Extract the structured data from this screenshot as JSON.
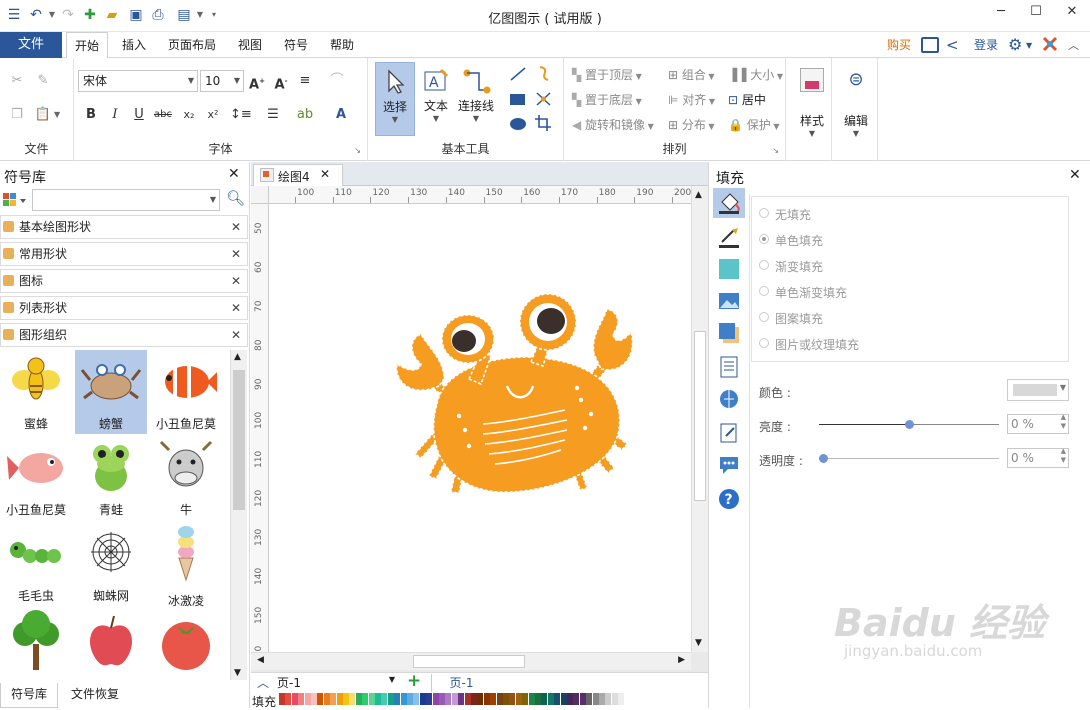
{
  "window": {
    "title": "亿图图示 ( 试用版 )"
  },
  "titlebar_right": {
    "buy": "购买",
    "login": "登录"
  },
  "tabs": {
    "file": "文件",
    "home": "开始",
    "insert": "插入",
    "page_layout": "页面布局",
    "view": "视图",
    "symbol": "符号",
    "help": "帮助"
  },
  "ribbon": {
    "groups": {
      "file": "文件",
      "font": "字体",
      "basic_tools": "基本工具",
      "arrange": "排列"
    },
    "font_name": "宋体",
    "font_size": "10",
    "tools": {
      "select": "选择",
      "text": "文本",
      "connector": "连接线"
    },
    "arrange": {
      "bring_front": "置于顶层",
      "send_back": "置于底层",
      "rotate": "旋转和镜像",
      "group": "组合",
      "align": "对齐",
      "distribute": "分布",
      "size": "大小",
      "center": "居中",
      "protect": "保护"
    },
    "style": "样式",
    "edit": "编辑"
  },
  "library": {
    "title": "符号库",
    "search_placeholder": "",
    "categories": [
      "基本绘图形状",
      "常用形状",
      "图标",
      "列表形状",
      "图形组织"
    ],
    "symbols": [
      "蜜蜂",
      "螃蟹",
      "小丑鱼尼莫",
      "小丑鱼尼莫",
      "青蛙",
      "牛",
      "毛毛虫",
      "蜘蛛网",
      "冰激凌"
    ],
    "bottom_tabs": {
      "library": "符号库",
      "recovery": "文件恢复"
    }
  },
  "document": {
    "tab": "绘图4",
    "ruler_h": [
      "100",
      "110",
      "120",
      "130",
      "140",
      "150",
      "160",
      "170",
      "180",
      "190",
      "200"
    ],
    "ruler_v": [
      "50",
      "60",
      "70",
      "80",
      "90",
      "100",
      "110",
      "120",
      "130",
      "140",
      "150",
      "160"
    ],
    "page_combo": "页-1",
    "page_tab": "页-1"
  },
  "fill_panel": {
    "title": "填充",
    "options": [
      "无填充",
      "单色填充",
      "渐变填充",
      "单色渐变填充",
      "图案填充",
      "图片或纹理填充"
    ],
    "color_label": "颜色 :",
    "brightness_label": "亮度 :",
    "brightness_value": "0 %",
    "brightness_level": 0.5,
    "transparency_label": "透明度 :",
    "transparency_value": "0 %",
    "transparency_level": 0
  },
  "statusbar": {
    "fill_label": "填充"
  },
  "colors": {
    "accent": "#2b579a",
    "selected": "#b5c9e8",
    "crab": "#f59c21",
    "slider": "#6f93d6"
  }
}
